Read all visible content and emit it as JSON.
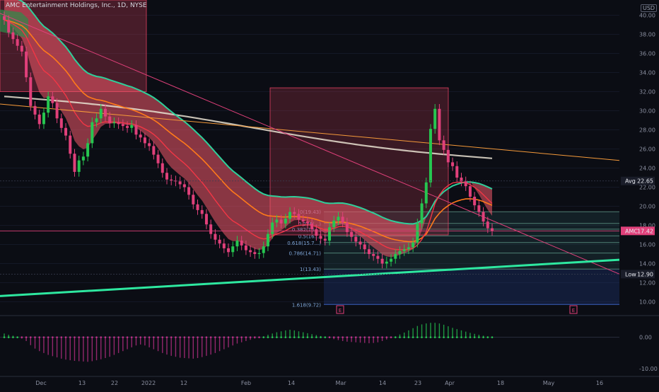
{
  "header": {
    "title": "AMC Entertainment Holdings, Inc., 1D, NYSE",
    "currency": "USD"
  },
  "colors": {
    "background": "#0b0d14",
    "bull": "#26c650",
    "bear": "#e0407a",
    "ema_fast": "#f23645",
    "ema_mid": "#ff7a1a",
    "ema_slow": "#2fcf9a",
    "ema_long": "#e8e0d0",
    "trend_orange": "#f59a3a",
    "trend_pink": "#e0407a",
    "support": "#2ee8a0",
    "cloud": "#f25a6a",
    "fib_zone": "#1f3a7a"
  },
  "chart_data": {
    "type": "candlestick",
    "title": "AMC Entertainment Holdings, Inc., 1D, NYSE",
    "price_axis": {
      "ticks": [
        "40.00",
        "38.00",
        "36.00",
        "34.00",
        "32.00",
        "30.00",
        "28.00",
        "26.00",
        "24.00",
        "22.00",
        "20.00",
        "18.00",
        "16.00",
        "14.00",
        "12.00",
        "10.00"
      ],
      "ylim": [
        9,
        41
      ]
    },
    "time_axis": {
      "ticks": [
        "Dec",
        "13",
        "22",
        "2022",
        "12",
        "Feb",
        "14",
        "Mar",
        "14",
        "23",
        "Apr",
        "18",
        "May",
        "16"
      ]
    },
    "price_badges": [
      {
        "label": "Avg",
        "value": "22.65",
        "price": 22.65
      },
      {
        "label": "AMC",
        "value": "17.42",
        "price": 17.42
      },
      {
        "label": "Low",
        "value": "12.90",
        "price": 12.9
      }
    ],
    "fib_levels": [
      {
        "label": "0(19.43)",
        "price": 19.43
      },
      {
        "label": "0.236(...)",
        "price": 18.2
      },
      {
        "label": "0.382(16...)",
        "price": 17.6
      },
      {
        "label": "0.5(16...)",
        "price": 16.9
      },
      {
        "label": "0.618(15.7...)",
        "price": 16.2
      },
      {
        "label": "0.786(14.71)",
        "price": 15.1
      },
      {
        "label": "1(13.43)",
        "price": 13.43
      },
      {
        "label": "1.618(9.72)",
        "price": 9.72
      }
    ],
    "earnings_markers": [
      "E",
      "E"
    ],
    "candles_close": [
      39.5,
      38.2,
      37.5,
      36.8,
      36.2,
      33.5,
      30.5,
      29.6,
      28.6,
      29.8,
      31.5,
      30.8,
      29.2,
      28.2,
      27.4,
      25.5,
      23.6,
      24.8,
      25.2,
      26.6,
      28.8,
      29.2,
      30.2,
      29.4,
      28.7,
      28.8,
      28.6,
      28.4,
      28.2,
      28.5,
      27.5,
      27.2,
      26.6,
      26.3,
      25.4,
      24.5,
      23.5,
      22.8,
      22.7,
      22.6,
      22.3,
      22.0,
      21.2,
      20.2,
      19.6,
      19.2,
      18.1,
      17.1,
      16.5,
      16.1,
      15.6,
      15.2,
      15.8,
      16.4,
      15.9,
      15.4,
      15.2,
      15.0,
      15.1,
      15.8,
      17.1,
      18.3,
      18.6,
      18.2,
      18.7,
      19.4,
      19.2,
      18.6,
      18.4,
      18.2,
      17.6,
      16.9,
      16.6,
      16.4,
      17.8,
      18.5,
      18.9,
      18.3,
      17.3,
      16.8,
      16.3,
      16.0,
      15.5,
      15.0,
      14.8,
      14.5,
      14.0,
      14.2,
      14.5,
      15.0,
      15.3,
      15.5,
      15.7,
      16.2,
      18.2,
      20.3,
      22.5,
      28.1,
      30.2,
      26.9,
      25.9,
      24.6,
      24.2,
      23.0,
      22.6,
      22.1,
      21.0,
      20.1,
      19.4,
      18.4,
      17.7,
      17.42
    ],
    "oscillator": {
      "ticks": [
        "0.00",
        "-10.00"
      ],
      "ylim": [
        -12,
        6
      ],
      "values": [
        1.2,
        0.8,
        0.5,
        0.1,
        -0.4,
        -1.2,
        -2.5,
        -3.6,
        -4.4,
        -5.0,
        -5.6,
        -6.0,
        -6.4,
        -6.8,
        -7.1,
        -7.3,
        -7.5,
        -7.6,
        -7.7,
        -7.8,
        -7.6,
        -7.3,
        -7.0,
        -6.6,
        -6.2,
        -5.6,
        -5.0,
        -4.4,
        -3.8,
        -3.2,
        -2.6,
        -2.3,
        -2.6,
        -3.2,
        -3.8,
        -4.4,
        -5.0,
        -5.5,
        -5.9,
        -6.2,
        -6.5,
        -6.6,
        -6.7,
        -6.8,
        -6.6,
        -6.3,
        -5.9,
        -5.5,
        -5.0,
        -4.4,
        -3.8,
        -3.2,
        -2.6,
        -2.0,
        -1.6,
        -1.2,
        -0.8,
        -0.4,
        -0.1,
        0.3,
        0.8,
        1.2,
        1.6,
        1.9,
        2.2,
        2.4,
        2.2,
        1.9,
        1.6,
        1.3,
        1.0,
        0.7,
        0.4,
        0.1,
        -0.3,
        -0.6,
        -0.9,
        -1.2,
        -1.4,
        -1.5,
        -1.6,
        -1.7,
        -1.8,
        -1.9,
        -1.8,
        -1.6,
        -1.2,
        -0.7,
        -0.2,
        0.3,
        0.9,
        1.5,
        2.2,
        2.9,
        3.6,
        4.1,
        4.4,
        4.6,
        4.6,
        4.4,
        4.0,
        3.5,
        3.0,
        2.6,
        2.2,
        1.8,
        1.4,
        1.1,
        0.8,
        0.5,
        0.3,
        0.2
      ]
    }
  }
}
